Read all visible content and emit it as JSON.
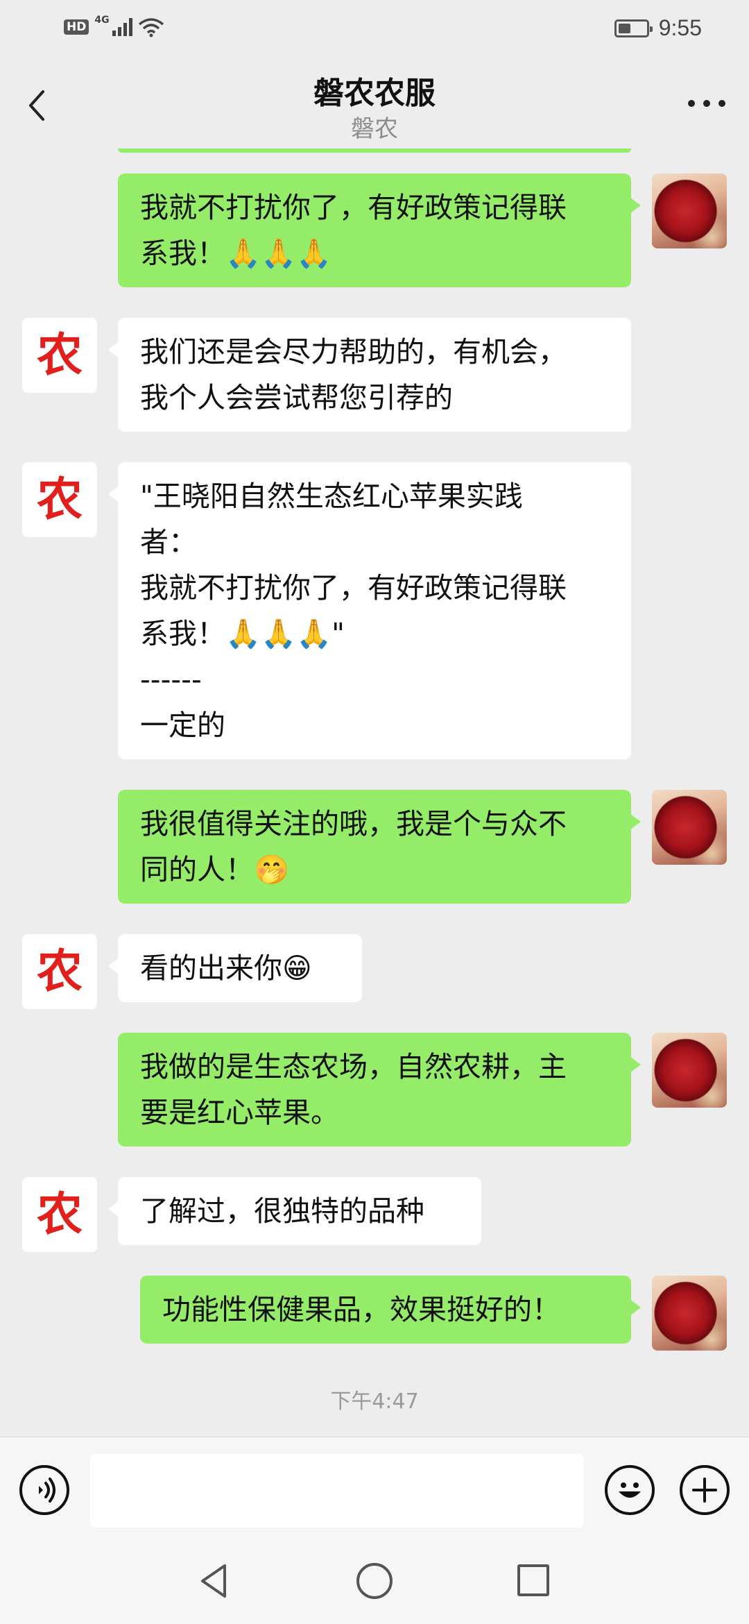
{
  "status_bar": {
    "hd": "HD",
    "network": "4G",
    "time": "9:55",
    "battery_level": 0.45
  },
  "header": {
    "title": "磐农农服",
    "subtitle": "磐农"
  },
  "messages": [
    {
      "sender": "me",
      "lines": [
        "我就不打扰你了，有好政策记得联",
        "系我！🙏🙏🙏"
      ]
    },
    {
      "sender": "them",
      "avatar_text": "农",
      "lines": [
        "我们还是会尽力帮助的，有机会，",
        "我个人会尝试帮您引荐的"
      ]
    },
    {
      "sender": "them",
      "avatar_text": "农",
      "lines": [
        "\"王晓阳自然生态红心苹果实践",
        "者：",
        "我就不打扰你了，有好政策记得联",
        "系我！🙏🙏🙏\"",
        "------",
        "一定的"
      ]
    },
    {
      "sender": "me",
      "lines": [
        "我很值得关注的哦，我是个与众不",
        "同的人！🤭"
      ]
    },
    {
      "sender": "them",
      "avatar_text": "农",
      "lines": [
        "看的出来你😁"
      ]
    },
    {
      "sender": "me",
      "lines": [
        "我做的是生态农场，自然农耕，主",
        "要是红心苹果。"
      ]
    },
    {
      "sender": "them",
      "avatar_text": "农",
      "lines": [
        "了解过，很独特的品种"
      ]
    },
    {
      "sender": "me",
      "lines": [
        "功能性保健果品，效果挺好的！"
      ]
    }
  ],
  "timestamp": "下午4:47",
  "input_bar": {
    "value": "",
    "placeholder": ""
  },
  "colors": {
    "my_bubble": "#95ec69",
    "their_bubble": "#ffffff",
    "chat_background": "#ededed",
    "avatar_logo": "#e0201c"
  },
  "icons": {
    "back": "chevron-left-icon",
    "more": "more-dots-icon",
    "voice": "voice-icon",
    "emoji": "emoji-icon",
    "plus": "plus-icon"
  }
}
